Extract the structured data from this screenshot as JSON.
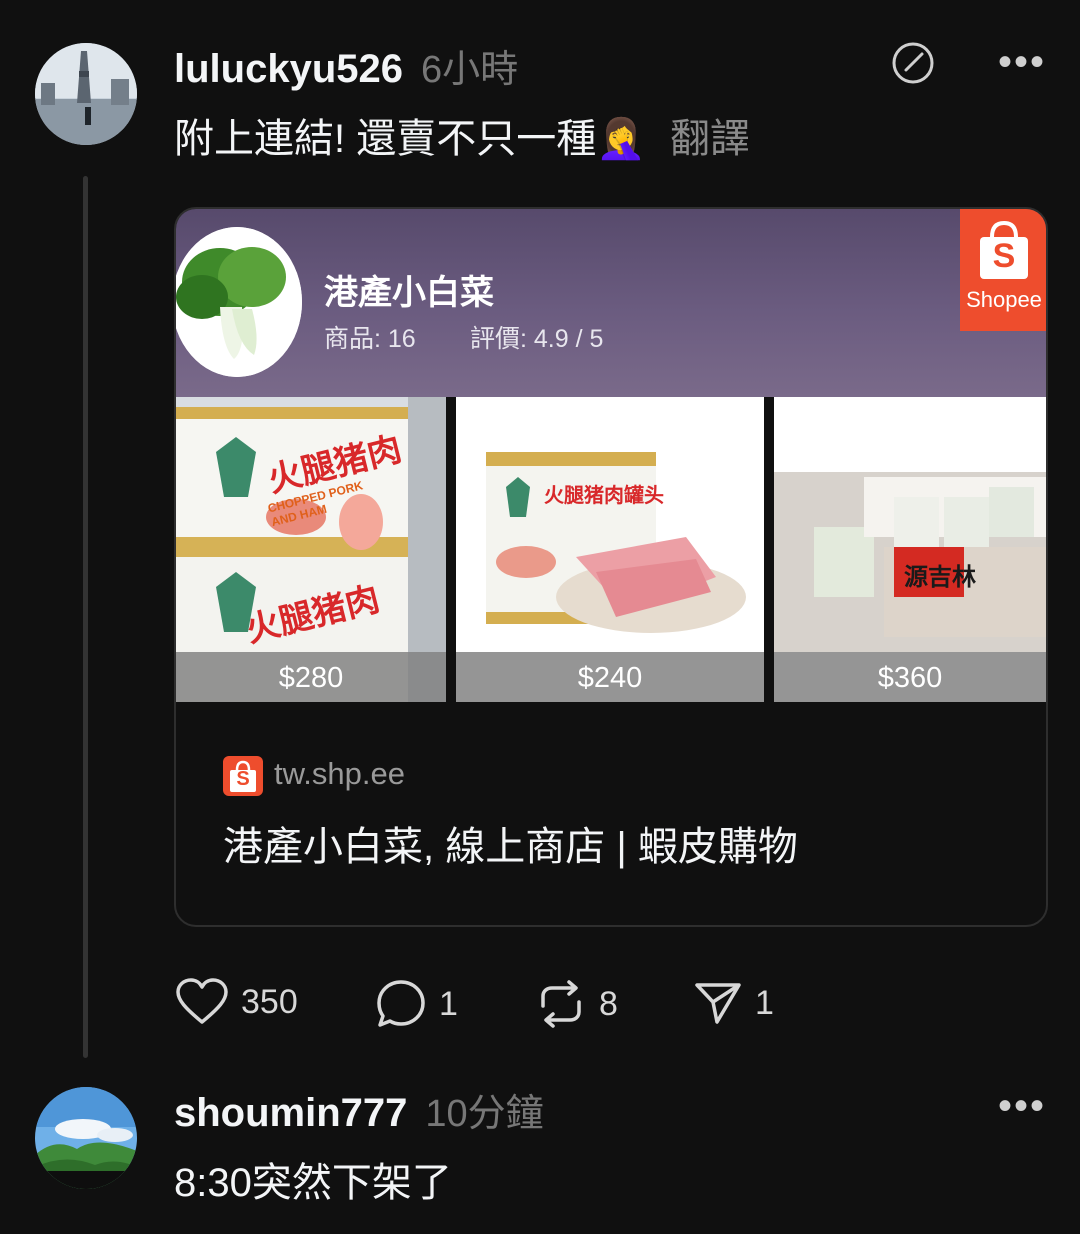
{
  "post": {
    "username": "luluckyu526",
    "time": "6小時",
    "text": "附上連結! 還賣不只一種🤦‍♀️",
    "translate_label": "翻譯",
    "more_icon": "more-horizontal-icon",
    "repost_edit_icon": "edit-circle-icon",
    "link_card": {
      "shop_name": "港產小白菜",
      "products_count": "商品: 16",
      "rating": "評價: 4.9 / 5",
      "badge_label": "Shopee",
      "badge_letter": "S",
      "products": [
        {
          "price": "$280",
          "label_top": "火腿猪肉",
          "label_sub": "CHOPPED PORK AND HAM"
        },
        {
          "price": "$240",
          "label_top": "火腿猪肉罐头"
        },
        {
          "price": "$360",
          "label_top": "源吉林"
        }
      ],
      "domain": "tw.shp.ee",
      "title": "港產小白菜, 線上商店 | 蝦皮購物"
    },
    "actions": {
      "likes": "350",
      "replies": "1",
      "reposts": "8",
      "shares": "1"
    }
  },
  "reply": {
    "username": "shoumin777",
    "time": "10分鐘",
    "text": "8:30突然下架了"
  },
  "colors": {
    "background": "#101010",
    "shopee_orange": "#ee4d2d",
    "muted": "#777777"
  }
}
